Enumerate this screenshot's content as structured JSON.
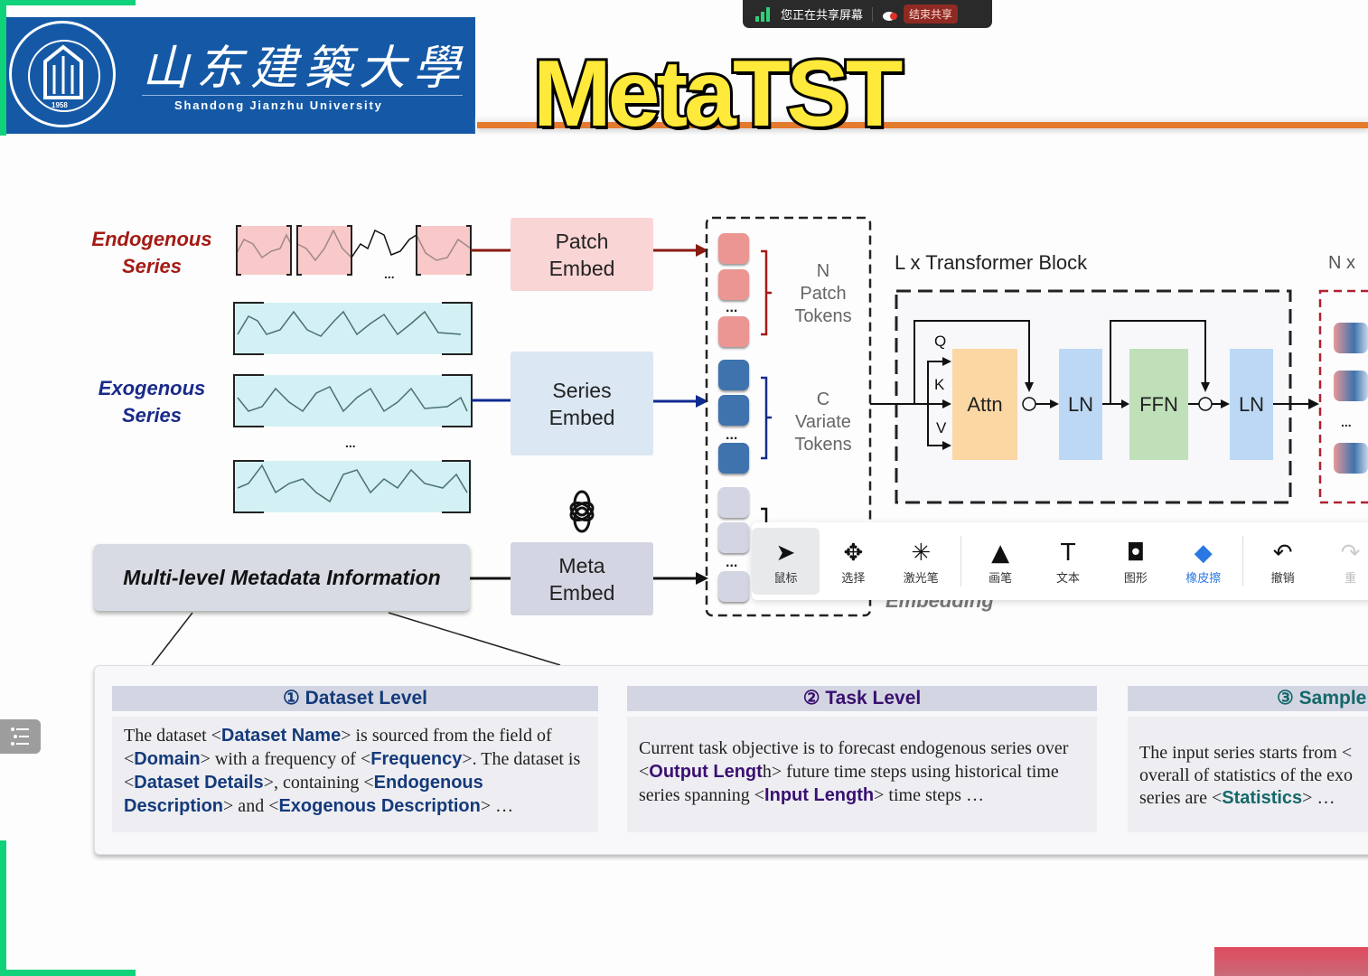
{
  "share_bar": {
    "status": "您正在共享屏幕",
    "stop_label": "结束共享",
    "icons": [
      "signal-icon",
      "cloud-record-icon"
    ]
  },
  "logo": {
    "chinese_name": "山东建築大學",
    "english_name": "Shandong Jianzhu University",
    "seal_year": "1958",
    "brand_color": "#1559a6"
  },
  "slide": {
    "title": "MetaTST",
    "accent_color": "#e47a2e",
    "title_color": "#ffe93a"
  },
  "diagram": {
    "endogenous_label": [
      "Endogenous",
      "Series"
    ],
    "exogenous_label": [
      "Exogenous",
      "Series"
    ],
    "ellipsis": "...",
    "patch_embed": [
      "Patch",
      "Embed"
    ],
    "series_embed": [
      "Series",
      "Embed"
    ],
    "meta_embed": [
      "Meta",
      "Embed"
    ],
    "patch_tokens": [
      "N",
      "Patch",
      "Tokens"
    ],
    "variate_tokens": [
      "C",
      "Variate",
      "Tokens"
    ],
    "transformer_label": "L x Transformer Block",
    "output_label": "N x",
    "qkv": [
      "Q",
      "K",
      "V"
    ],
    "attn": "Attn",
    "ln": "LN",
    "ffn": "FFN",
    "plus": "+",
    "hidden_partial": "Embedding",
    "metadata_box": "Multi-level Metadata Information",
    "colors": {
      "endogenous": "#a31b14",
      "exogenous": "#1a2a88",
      "patch": "#fad5d6",
      "series": "#dbe7f3",
      "meta": "#d3d6e2",
      "attn": "#fbd7a4",
      "ln": "#bcd8f5",
      "ffn": "#bfe0b8"
    }
  },
  "levels": [
    {
      "header": "① Dataset Level",
      "color": "#143a7a",
      "segments": [
        [
          "t",
          "The dataset <"
        ],
        [
          "b",
          "Dataset Name"
        ],
        [
          "t",
          "> is sourced from the field of <"
        ],
        [
          "b",
          "Domain"
        ],
        [
          "t",
          "> with a frequency of <"
        ],
        [
          "b",
          "Frequency"
        ],
        [
          "t",
          ">. The dataset is  <"
        ],
        [
          "b",
          "Dataset Details"
        ],
        [
          "t",
          ">, containing <"
        ],
        [
          "b",
          "Endogenous Description"
        ],
        [
          "t",
          "> and  <"
        ],
        [
          "b",
          "Exogenous Description"
        ],
        [
          "t",
          "> …"
        ]
      ]
    },
    {
      "header": "② Task Level",
      "color": "#3a1070",
      "segments": [
        [
          "t",
          "Current task objective is to forecast endogenous series over <"
        ],
        [
          "b",
          "Output Lengt"
        ],
        [
          "t",
          "h> future time steps using historical time series spanning <"
        ],
        [
          "b",
          "Input Length"
        ],
        [
          "t",
          "> time steps …"
        ]
      ]
    },
    {
      "header": "③ Sample",
      "color": "#14686a",
      "segments": [
        [
          "t",
          "The input series starts from <"
        ],
        [
          "t",
          " overall of statistics of the exo"
        ],
        [
          "t",
          " series are <"
        ],
        [
          "b",
          "Statistics"
        ],
        [
          "t",
          "> …"
        ]
      ]
    }
  ],
  "toolbar": {
    "tools": [
      {
        "label": "鼠标",
        "icon": "cursor-icon",
        "glyph": "➤",
        "state": "active"
      },
      {
        "label": "选择",
        "icon": "move-icon",
        "glyph": "✥",
        "state": ""
      },
      {
        "label": "激光笔",
        "icon": "laser-pointer-icon",
        "glyph": "✳",
        "state": ""
      },
      {
        "label": "画笔",
        "icon": "pen-icon",
        "glyph": "▲",
        "state": ""
      },
      {
        "label": "文本",
        "icon": "text-icon",
        "glyph": "T",
        "state": ""
      },
      {
        "label": "图形",
        "icon": "shape-icon",
        "glyph": "◘",
        "state": ""
      },
      {
        "label": "橡皮擦",
        "icon": "eraser-icon",
        "glyph": "◆",
        "state": "sel"
      },
      {
        "label": "撤销",
        "icon": "undo-icon",
        "glyph": "↶",
        "state": ""
      },
      {
        "label": "重",
        "icon": "redo-icon",
        "glyph": "↷",
        "state": "dis"
      }
    ]
  }
}
